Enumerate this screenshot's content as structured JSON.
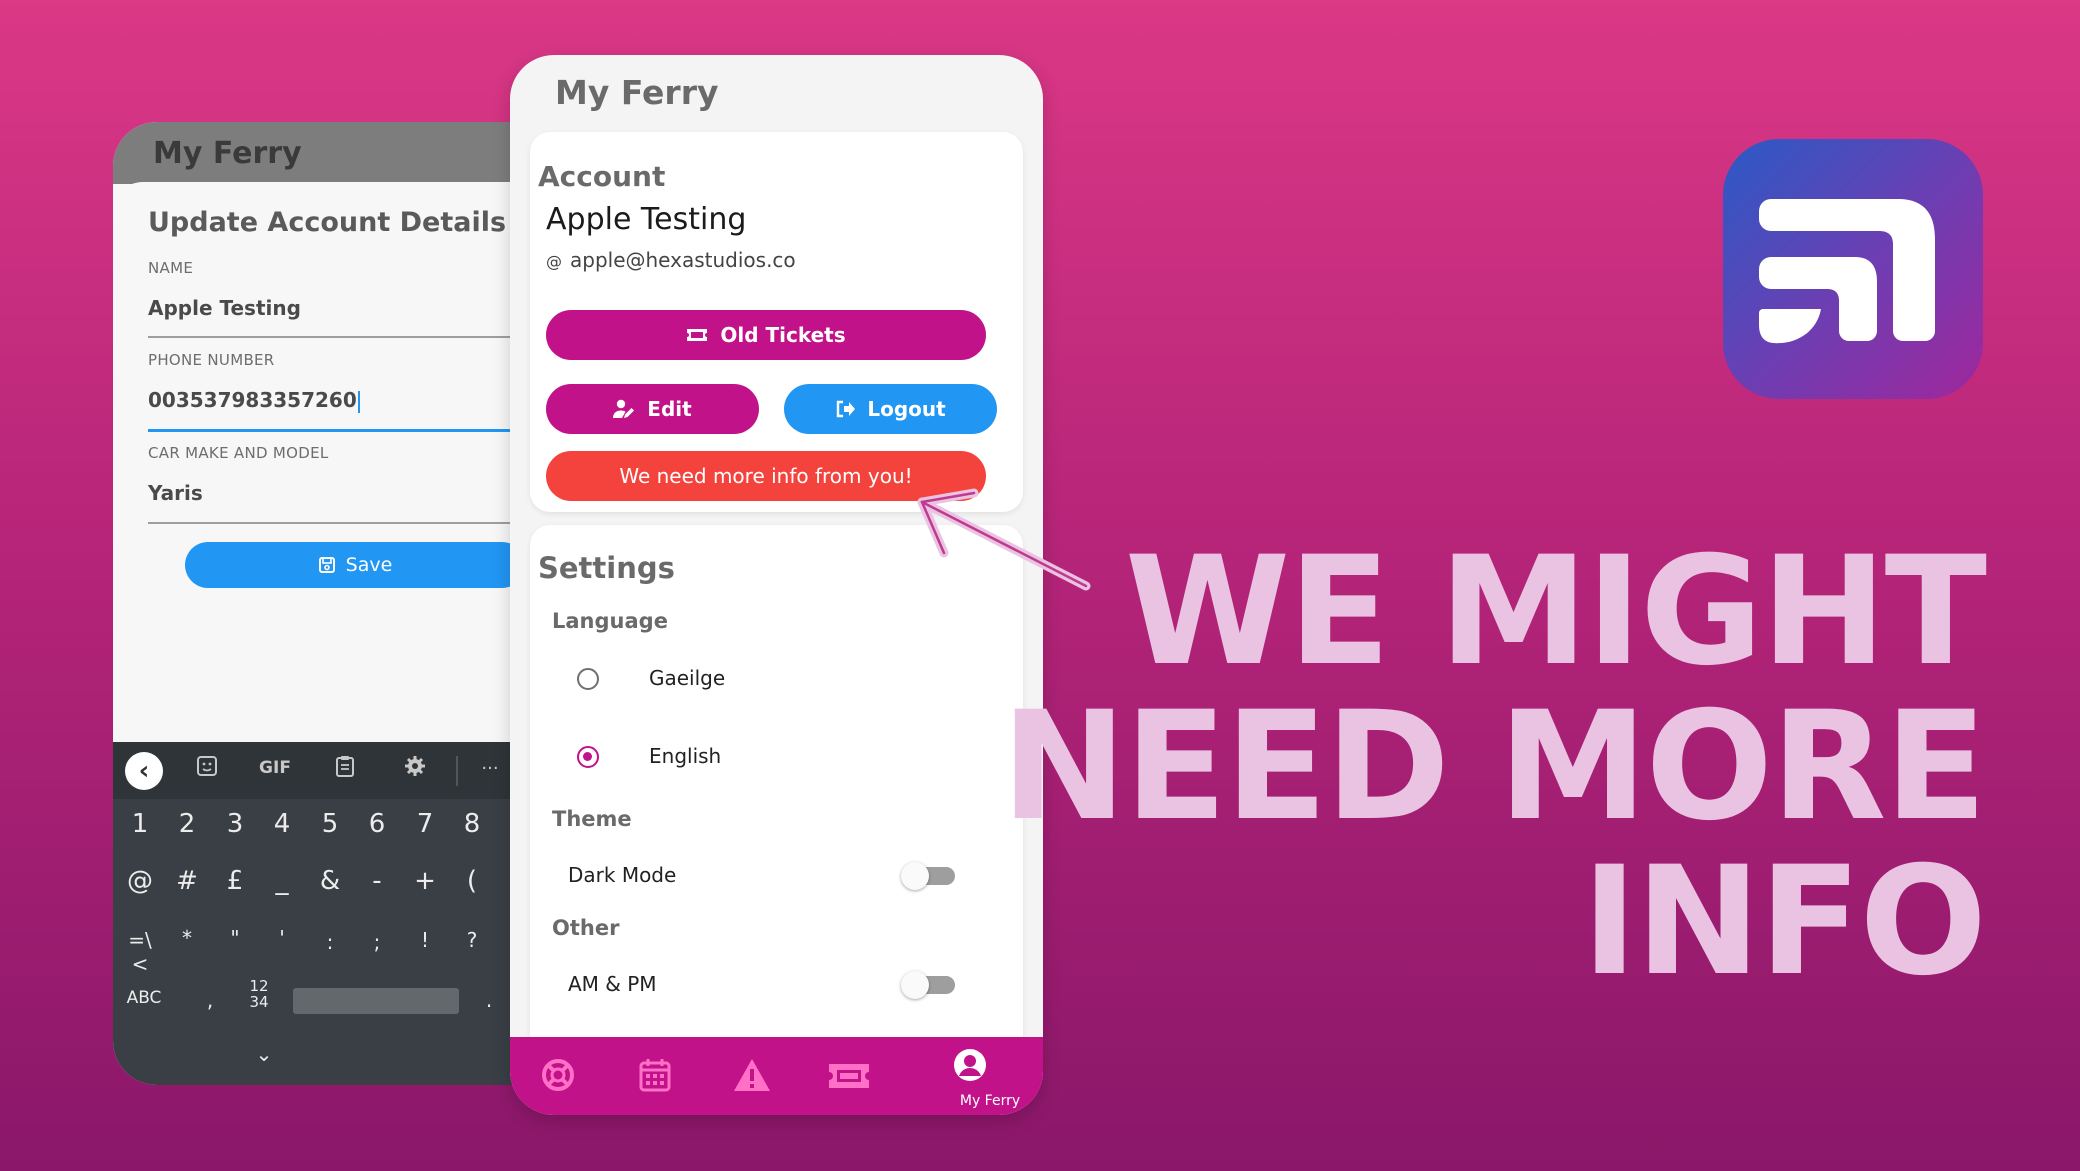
{
  "back_screen": {
    "app_title": "My Ferry",
    "form_title": "Update Account Details",
    "fields": [
      {
        "label": "NAME",
        "value": "Apple Testing"
      },
      {
        "label": "PHONE NUMBER",
        "value": "003537983357260"
      },
      {
        "label": "CAR MAKE AND MODEL",
        "value": "Yaris"
      }
    ],
    "save_label": "Save",
    "keyboard": {
      "toolbar": {
        "back": "‹",
        "gif": "GIF",
        "more": "···"
      },
      "row1": [
        "1",
        "2",
        "3",
        "4",
        "5",
        "6",
        "7",
        "8"
      ],
      "row2": [
        "@",
        "#",
        "£",
        "_",
        "&",
        "-",
        "+",
        "("
      ],
      "row3": [
        "=\\<",
        "*",
        "\"",
        "'",
        ":",
        ";",
        "!",
        "?"
      ],
      "row4": {
        "abc": "ABC",
        "comma": ",",
        "numpad_top": "12",
        "numpad_bottom": "34",
        "period": "."
      },
      "collapse": "⌄"
    }
  },
  "front_screen": {
    "app_title": "My Ferry",
    "account": {
      "heading": "Account",
      "name": "Apple Testing",
      "email_prefix": "@",
      "email": "apple@hexastudios.co",
      "old_tickets_label": "Old Tickets",
      "edit_label": "Edit",
      "logout_label": "Logout",
      "more_info_label": "We need more info from you!"
    },
    "settings": {
      "heading": "Settings",
      "language_heading": "Language",
      "languages": [
        {
          "label": "Gaeilge",
          "selected": false
        },
        {
          "label": "English",
          "selected": true
        }
      ],
      "theme_heading": "Theme",
      "dark_mode_label": "Dark Mode",
      "dark_mode_on": false,
      "other_heading": "Other",
      "ampm_label": "AM & PM",
      "ampm_on": false
    },
    "bottom_nav": {
      "items": [
        "help-icon",
        "calendar-icon",
        "alert-icon",
        "ticket-icon",
        "account-icon"
      ],
      "active_label": "My Ferry"
    }
  },
  "headline": {
    "line1": "WE MIGHT",
    "line2": "NEED MORE",
    "line3": "INFO"
  },
  "colors": {
    "brand_magenta": "#c2128a",
    "primary_blue": "#2196f3",
    "alert_red": "#f4433c",
    "headline": "#eac2e2"
  }
}
